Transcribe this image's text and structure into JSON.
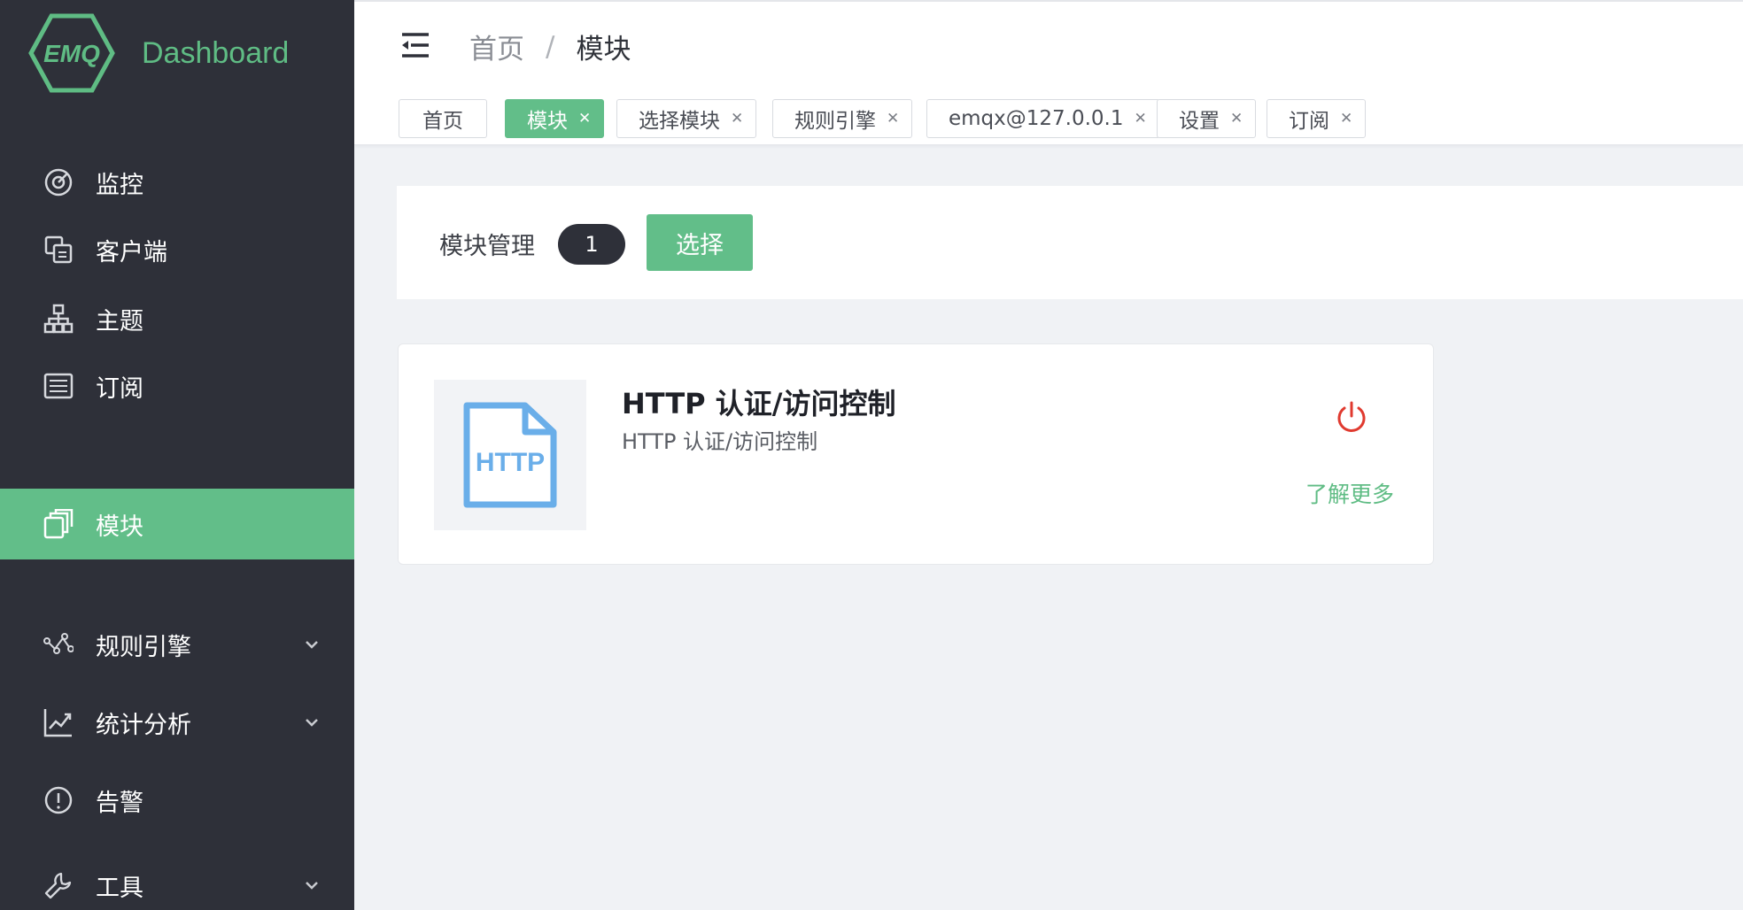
{
  "brand": {
    "name": "Dashboard",
    "logo_text": "EMQ",
    "color": "#5fbc84"
  },
  "sidebar": {
    "items": [
      {
        "label": "监控",
        "icon": "monitor-gauge-icon",
        "active": false
      },
      {
        "label": "客户端",
        "icon": "clients-icon",
        "active": false
      },
      {
        "label": "主题",
        "icon": "topics-tree-icon",
        "active": false
      },
      {
        "label": "订阅",
        "icon": "subscriptions-list-icon",
        "active": false
      },
      {
        "label": "模块",
        "icon": "modules-icon",
        "active": true
      },
      {
        "label": "规则引擎",
        "icon": "rule-engine-icon",
        "active": false,
        "expandable": true
      },
      {
        "label": "统计分析",
        "icon": "chart-icon",
        "active": false,
        "expandable": true
      },
      {
        "label": "告警",
        "icon": "alert-icon",
        "active": false
      },
      {
        "label": "工具",
        "icon": "wrench-icon",
        "active": false,
        "expandable": true
      }
    ]
  },
  "header": {
    "breadcrumb": [
      "首页",
      "模块"
    ],
    "separator": "/"
  },
  "tags": [
    {
      "label": "首页",
      "closable": false,
      "active": false
    },
    {
      "label": "模块",
      "closable": true,
      "active": true
    },
    {
      "label": "选择模块",
      "closable": true,
      "active": false
    },
    {
      "label": "规则引擎",
      "closable": true,
      "active": false
    },
    {
      "label": "emqx@127.0.0.1",
      "closable": true,
      "active": false
    },
    {
      "label": "设置",
      "closable": true,
      "active": false
    },
    {
      "label": "订阅",
      "closable": true,
      "active": false
    }
  ],
  "toolbar": {
    "title": "模块管理",
    "count": "1",
    "select_label": "选择"
  },
  "module": {
    "logo_text": "HTTP",
    "title": "HTTP 认证/访问控制",
    "description": "HTTP 认证/访问控制",
    "learn_more": "了解更多",
    "status_color": "#e03a2f"
  },
  "colors": {
    "sidebar_bg": "#2e3039",
    "accent": "#62be89",
    "logo_blue": "#6aaee9"
  }
}
